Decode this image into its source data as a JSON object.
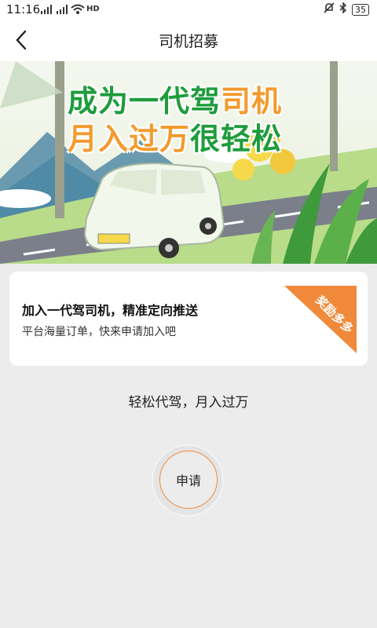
{
  "statusbar": {
    "time": "11:16",
    "battery": "35",
    "signal1": "4G",
    "signal2": "4G",
    "hd": "HD"
  },
  "header": {
    "title": "司机招募"
  },
  "banner": {
    "line1_green": "成为一代驾",
    "line1_orange": "司机",
    "line2_orange": "月入过万",
    "line2_green": "很轻松"
  },
  "card": {
    "headline": "加入一代驾司机，精准定向推送",
    "subline": "平台海量订单，快来申请加入吧",
    "ribbon": "奖励多多"
  },
  "slogan": "轻松代驾，月入过万",
  "apply_button": {
    "label": "申请"
  },
  "colors": {
    "green": "#1e9c3c",
    "orange": "#f39a2e",
    "accent": "#f08a3a"
  }
}
